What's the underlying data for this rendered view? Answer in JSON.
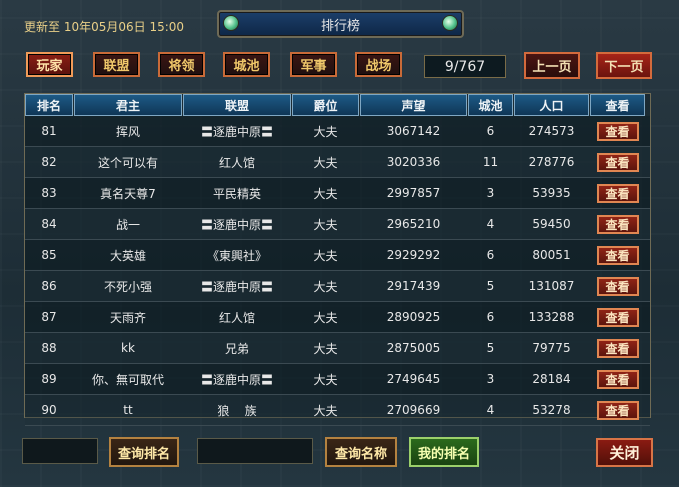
{
  "header": {
    "updated_text": "更新至 10年05月06日 15:00",
    "title": "排行榜"
  },
  "tabs": [
    {
      "label": "玩家",
      "active": true
    },
    {
      "label": "联盟",
      "active": false
    },
    {
      "label": "将领",
      "active": false
    },
    {
      "label": "城池",
      "active": false
    },
    {
      "label": "军事",
      "active": false
    },
    {
      "label": "战场",
      "active": false
    }
  ],
  "pager": {
    "page_display": "9/767",
    "prev_label": "上一页",
    "next_label": "下一页"
  },
  "table": {
    "headers": [
      "排名",
      "君主",
      "联盟",
      "爵位",
      "声望",
      "城池",
      "人口",
      "查看"
    ],
    "view_label": "查看",
    "rows": [
      {
        "rank": "81",
        "lord": "挥风",
        "alliance": "〓逐鹿中原〓",
        "title": "大夫",
        "prestige": "3067142",
        "cities": "6",
        "population": "274573"
      },
      {
        "rank": "82",
        "lord": "这个可以有",
        "alliance": "红人馆",
        "title": "大夫",
        "prestige": "3020336",
        "cities": "11",
        "population": "278776"
      },
      {
        "rank": "83",
        "lord": "真名天尊7",
        "alliance": "平民精英",
        "title": "大夫",
        "prestige": "2997857",
        "cities": "3",
        "population": "53935"
      },
      {
        "rank": "84",
        "lord": "战一",
        "alliance": "〓逐鹿中原〓",
        "title": "大夫",
        "prestige": "2965210",
        "cities": "4",
        "population": "59450"
      },
      {
        "rank": "85",
        "lord": "大英雄",
        "alliance": "《東興社》",
        "title": "大夫",
        "prestige": "2929292",
        "cities": "6",
        "population": "80051"
      },
      {
        "rank": "86",
        "lord": "不死小强",
        "alliance": "〓逐鹿中原〓",
        "title": "大夫",
        "prestige": "2917439",
        "cities": "5",
        "population": "131087"
      },
      {
        "rank": "87",
        "lord": "天雨齐",
        "alliance": "红人馆",
        "title": "大夫",
        "prestige": "2890925",
        "cities": "6",
        "population": "133288"
      },
      {
        "rank": "88",
        "lord": "kk",
        "alliance": "兄弟",
        "title": "大夫",
        "prestige": "2875005",
        "cities": "5",
        "population": "79775"
      },
      {
        "rank": "89",
        "lord": "你、無可取代",
        "alliance": "〓逐鹿中原〓",
        "title": "大夫",
        "prestige": "2749645",
        "cities": "3",
        "population": "28184"
      },
      {
        "rank": "90",
        "lord": "tt",
        "alliance": "狼    族",
        "title": "大夫",
        "prestige": "2709669",
        "cities": "4",
        "population": "53278"
      }
    ]
  },
  "bottom": {
    "search_rank_value": "",
    "search_rank_label": "查询排名",
    "search_name_value": "",
    "search_name_label": "查询名称",
    "my_rank_label": "我的排名",
    "close_label": "关闭"
  },
  "colors": {
    "accent_red": "#8f2416",
    "accent_gold": "#e8cf88",
    "header_blue": "#1d5a86",
    "green_button": "#2b6a1c"
  }
}
